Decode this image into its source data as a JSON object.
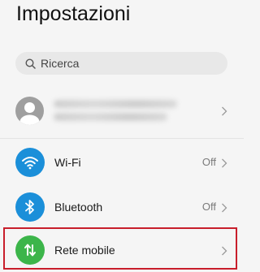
{
  "header": {
    "title": "Impostazioni"
  },
  "search": {
    "placeholder": "Ricerca"
  },
  "account": {
    "avatar_icon": "person-icon"
  },
  "settings": {
    "items": [
      {
        "label": "Wi-Fi",
        "status": "Off",
        "icon": "wifi-icon",
        "color": "#1b8fd9"
      },
      {
        "label": "Bluetooth",
        "status": "Off",
        "icon": "bluetooth-icon",
        "color": "#1b8fd9"
      },
      {
        "label": "Rete mobile",
        "status": "",
        "icon": "mobile-data-icon",
        "color": "#3cb54a"
      }
    ]
  },
  "highlight": {
    "color": "#c81e2b"
  }
}
